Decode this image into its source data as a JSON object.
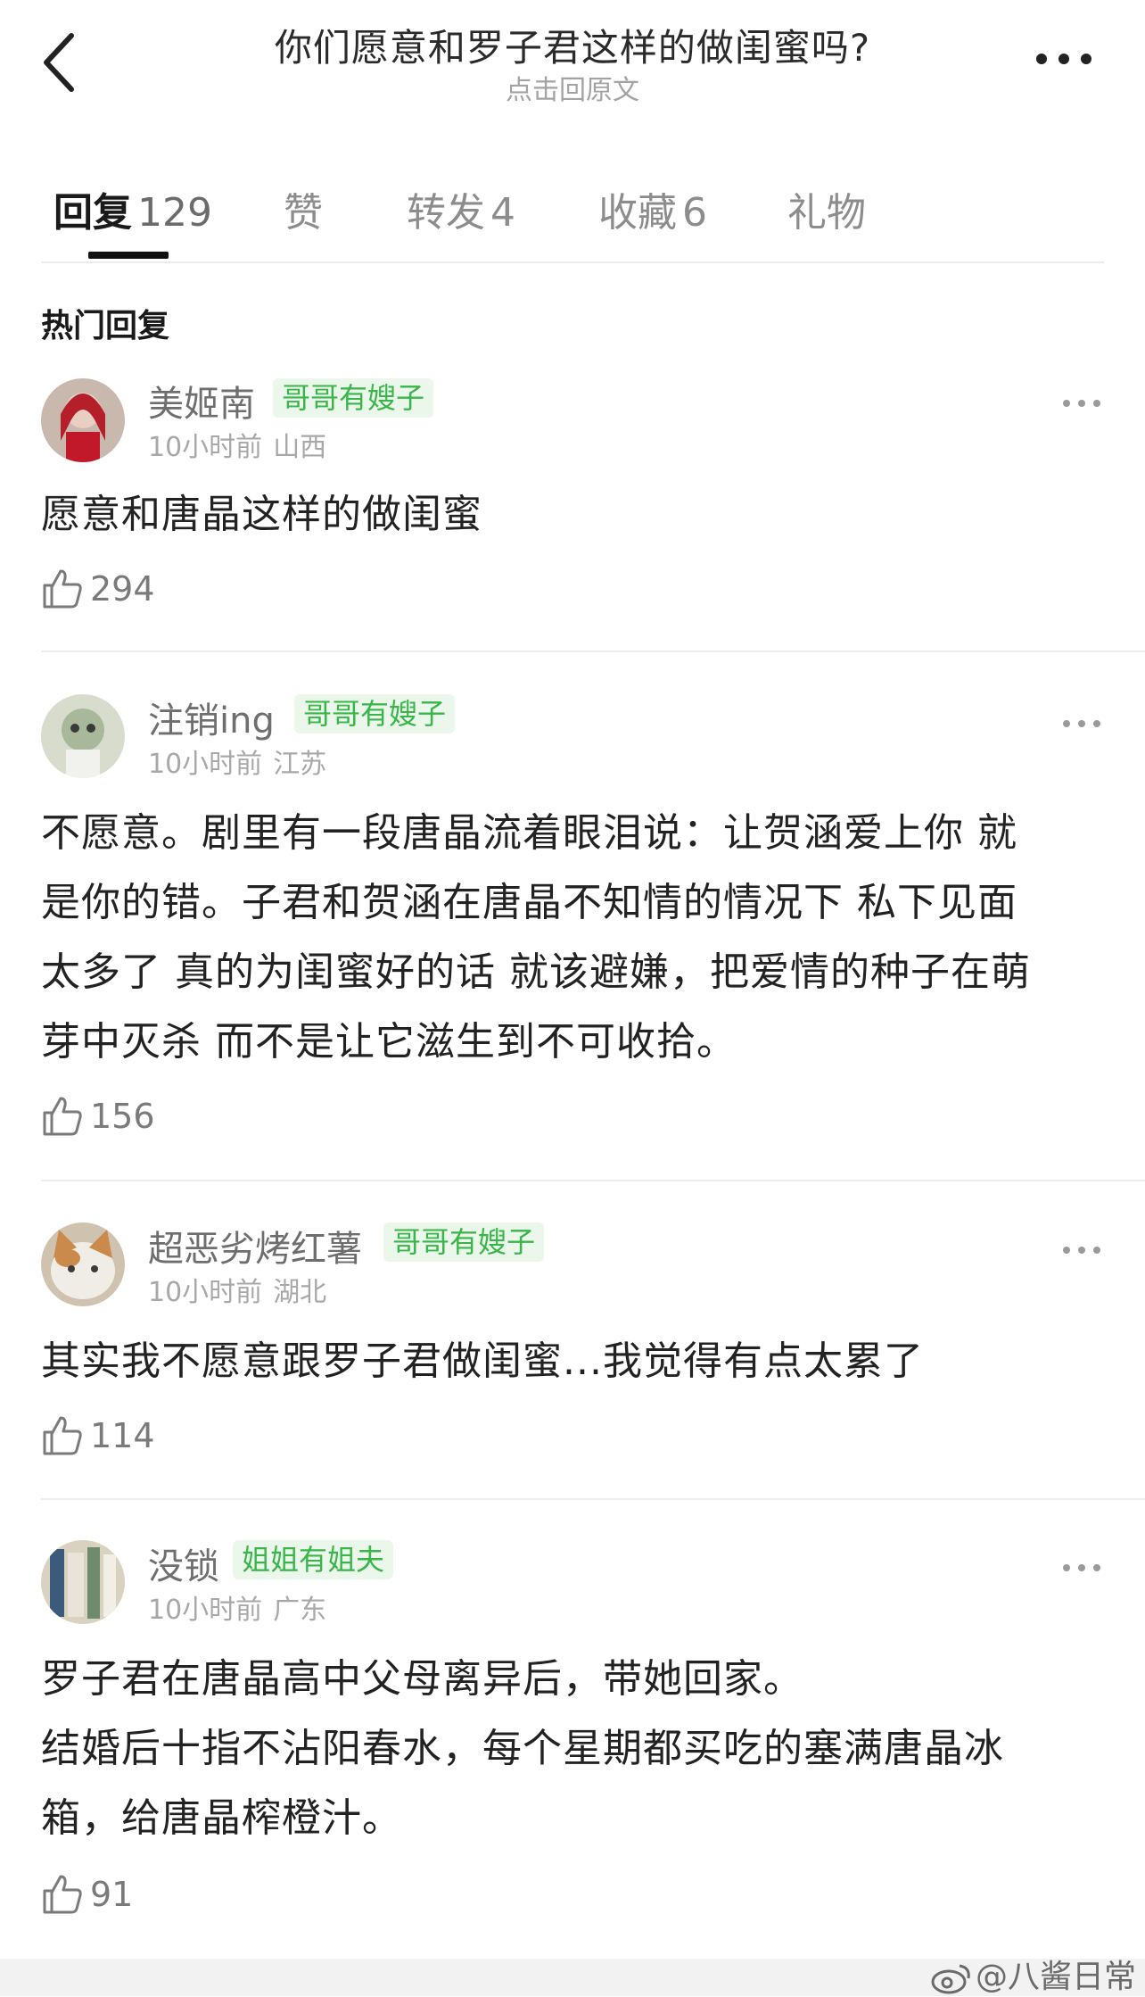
{
  "header": {
    "title": "你们愿意和罗子君这样的做闺蜜吗?",
    "subtitle": "点击回原文"
  },
  "tabs": [
    {
      "label": "回复",
      "count": "129"
    },
    {
      "label": "赞",
      "count": ""
    },
    {
      "label": "转发",
      "count": "4"
    },
    {
      "label": "收藏",
      "count": "6"
    },
    {
      "label": "礼物",
      "count": ""
    }
  ],
  "section_title": "热门回复",
  "comments": [
    {
      "username": "美姬南",
      "badge": "哥哥有嫂子",
      "time": "10小时前",
      "location": "山西",
      "lines": [
        "愿意和唐晶这样的做闺蜜"
      ],
      "likes": "294"
    },
    {
      "username": "注销ing",
      "badge": "哥哥有嫂子",
      "time": "10小时前",
      "location": "江苏",
      "lines": [
        "不愿意。剧里有一段唐晶流着眼泪说：让贺涵爱上你   就",
        "是你的错。子君和贺涵在唐晶不知情的情况下  私下见面",
        "太多了  真的为闺蜜好的话 就该避嫌，把爱情的种子在萌",
        "芽中灭杀  而不是让它滋生到不可收拾。"
      ],
      "likes": "156"
    },
    {
      "username": "超恶劣烤红薯",
      "badge": "哥哥有嫂子",
      "time": "10小时前",
      "location": "湖北",
      "lines": [
        "其实我不愿意跟罗子君做闺蜜...我觉得有点太累了"
      ],
      "likes": "114"
    },
    {
      "username": "没锁",
      "badge": "姐姐有姐夫",
      "time": "10小时前",
      "location": "广东",
      "lines": [
        "罗子君在唐晶高中父母离异后，带她回家。",
        "结婚后十指不沾阳春水，每个星期都买吃的塞满唐晶冰",
        "箱，给唐晶榨橙汁。"
      ],
      "likes": "91"
    }
  ],
  "watermark": "@八酱日常",
  "colors": {
    "badge_text": "#39b54a",
    "badge_bg": "#eaf7ea",
    "meta_gray": "#a8a8a8"
  },
  "icons": [
    "back-arrow-icon",
    "more-icon",
    "thumbs-up-icon",
    "weibo-icon"
  ]
}
